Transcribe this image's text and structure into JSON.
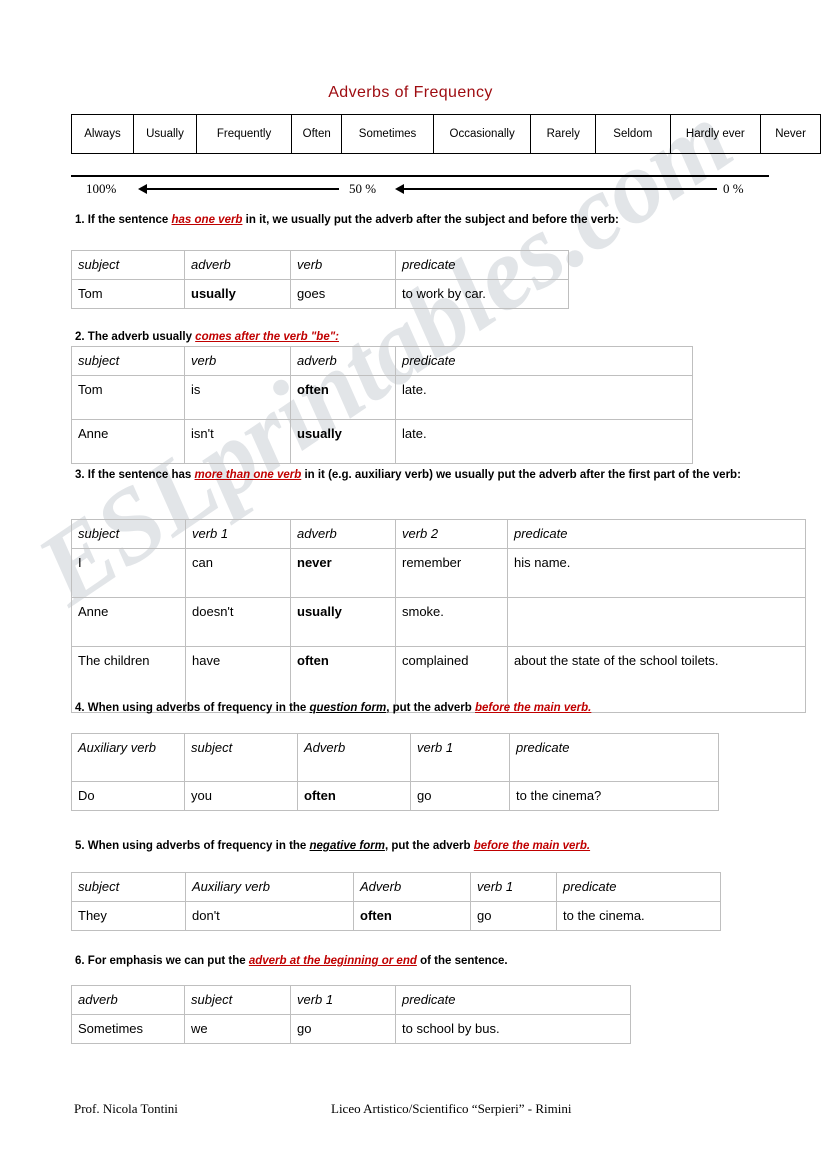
{
  "document": {
    "title": "Adverbs of Frequency",
    "title_color": "#9e0b10",
    "watermark": "ESLprintables.com"
  },
  "frequency_scale": {
    "adverbs": [
      "Always",
      "Usually",
      "Frequently",
      "Often",
      "Sometimes",
      "Occasionally",
      "Rarely",
      "Seldom",
      "Hardly ever",
      "Never"
    ],
    "percent_left": "100%",
    "percent_mid": "50 %",
    "percent_right": "0 %"
  },
  "rules": [
    {
      "number": "1.",
      "before": " If the sentence ",
      "highlight": "has one verb",
      "after": " in it, we usually put the adverb after the subject and before the verb:"
    },
    {
      "number": "2.",
      "before": " The adverb usually ",
      "highlight": "comes after the verb \"be\":",
      "after": ""
    },
    {
      "number": "3.",
      "before": " If the sentence has ",
      "highlight": "more than one verb",
      "after": " in it (e.g. auxiliary verb) we usually put the adverb after the first part of the verb:"
    },
    {
      "number": "4.",
      "before": " When using adverbs of frequency in the ",
      "underline": "question form",
      "middle": ", put the adverb ",
      "highlight": "before the main verb.",
      "after": ""
    },
    {
      "number": "5.",
      "before": " When using adverbs of frequency in the ",
      "underline": "negative form",
      "middle": ", put the adverb ",
      "highlight": "before the main verb.",
      "after": ""
    },
    {
      "number": "6.",
      "before": " For emphasis we can put the ",
      "highlight": "adverb at the beginning or end",
      "after": " of the sentence."
    }
  ],
  "tables": [
    {
      "id": "table-1",
      "headers": [
        "subject",
        "adverb",
        "verb",
        "predicate"
      ],
      "rows": [
        {
          "cells": [
            "Tom",
            "usually",
            "goes",
            "to work by car."
          ],
          "bold_index": 1
        }
      ]
    },
    {
      "id": "table-2",
      "headers": [
        "subject",
        "verb",
        "adverb",
        "predicate"
      ],
      "rows": [
        {
          "cells": [
            "Tom",
            "is",
            "often",
            "late."
          ],
          "bold_index": 2
        },
        {
          "cells": [
            "Anne",
            "isn't",
            "usually",
            "late."
          ],
          "bold_index": 2
        }
      ]
    },
    {
      "id": "table-3",
      "headers": [
        "subject",
        "verb 1",
        "adverb",
        "verb 2",
        "predicate"
      ],
      "rows": [
        {
          "cells": [
            "I",
            "can",
            "never",
            "remember",
            "his name."
          ],
          "bold_index": 2
        },
        {
          "cells": [
            "Anne",
            "doesn't",
            "usually",
            "smoke.",
            ""
          ],
          "bold_index": 2
        },
        {
          "cells": [
            "The children",
            "have",
            "often",
            "complained",
            "about the state of the school toilets."
          ],
          "bold_index": 2
        }
      ]
    },
    {
      "id": "table-4",
      "headers": [
        "Auxiliary verb",
        "subject",
        "Adverb",
        "verb 1",
        "predicate"
      ],
      "rows": [
        {
          "cells": [
            "Do",
            "you",
            "often",
            "go",
            "to the cinema?"
          ],
          "bold_index": 2
        }
      ]
    },
    {
      "id": "table-5",
      "headers": [
        "subject",
        "Auxiliary verb",
        "Adverb",
        "verb 1",
        "predicate"
      ],
      "rows": [
        {
          "cells": [
            "They",
            "don't",
            "often",
            "go",
            "to the cinema."
          ],
          "bold_index": 2
        }
      ]
    },
    {
      "id": "table-6",
      "headers": [
        "adverb",
        "subject",
        "verb 1",
        "predicate"
      ],
      "rows": [
        {
          "cells": [
            "Sometimes",
            "we",
            "go",
            "to school by bus."
          ],
          "bold_index": -1
        }
      ]
    }
  ],
  "footer": {
    "author": "Prof. Nicola Tontini",
    "school": "Liceo Artistico/Scientifico “Serpieri” - Rimini"
  }
}
